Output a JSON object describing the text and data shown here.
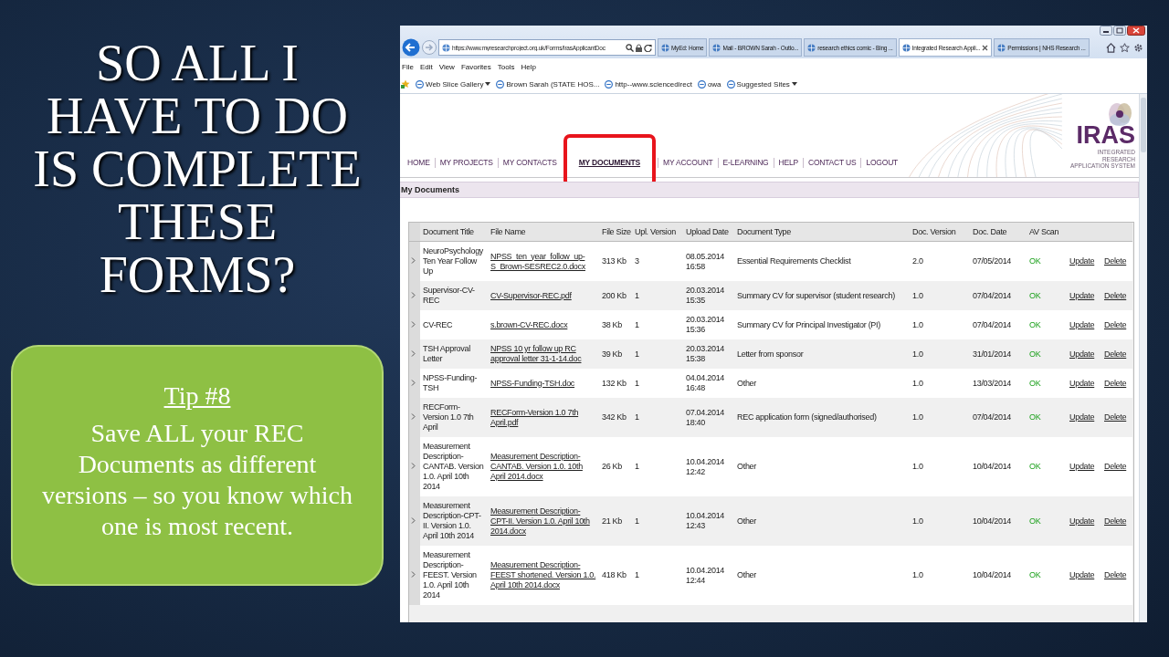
{
  "slide": {
    "title": "SO ALL I HAVE TO DO IS COMPLETE THESE FORMS?",
    "tip": {
      "heading": "Tip #8",
      "text": "Save ALL your REC Documents as different versions – so you know which one is most recent."
    }
  },
  "browser": {
    "address": "https://www.myresearchproject.org.uk/Forms/IrasApplicantDoc",
    "tabs": [
      {
        "label": "MyEd: Home",
        "selected": false
      },
      {
        "label": "Mail - BROWN Sarah - Outlo...",
        "selected": false
      },
      {
        "label": "research ethics comic - Bing ...",
        "selected": false
      },
      {
        "label": "Integrated Research Appli...",
        "selected": true
      },
      {
        "label": "Permissions | NHS Research ...",
        "selected": false
      }
    ],
    "menu": [
      "File",
      "Edit",
      "View",
      "Favorites",
      "Tools",
      "Help"
    ],
    "favorites": [
      {
        "label": "Web Slice Gallery",
        "dropdown": true
      },
      {
        "label": "Brown Sarah (STATE HOS...",
        "dropdown": false
      },
      {
        "label": "http--www.sciencedirect",
        "dropdown": false
      },
      {
        "label": "owa",
        "dropdown": false
      },
      {
        "label": "Suggested Sites",
        "dropdown": true
      }
    ]
  },
  "site": {
    "logo": {
      "name": "IRAS",
      "subtitle": "INTEGRATED RESEARCH APPLICATION SYSTEM"
    },
    "nav": [
      {
        "label": "HOME",
        "selected": false,
        "highlighted": false
      },
      {
        "label": "MY PROJECTS",
        "selected": false,
        "highlighted": false
      },
      {
        "label": "MY CONTACTS",
        "selected": false,
        "highlighted": false
      },
      {
        "label": "MY DOCUMENTS",
        "selected": true,
        "highlighted": true
      },
      {
        "label": "MY ACCOUNT",
        "selected": false,
        "highlighted": false
      },
      {
        "label": "E-LEARNING",
        "selected": false,
        "highlighted": false
      },
      {
        "label": "HELP",
        "selected": false,
        "highlighted": false
      },
      {
        "label": "CONTACT US",
        "selected": false,
        "highlighted": false
      },
      {
        "label": "LOGOUT",
        "selected": false,
        "highlighted": false
      }
    ],
    "section_title": "My Documents",
    "table": {
      "columns": [
        "Document Title",
        "File Name",
        "File Size",
        "Upl. Version",
        "Upload Date",
        "Document Type",
        "Doc. Version",
        "Doc. Date",
        "AV Scan"
      ],
      "rows": [
        {
          "title": "NeuroPsychology Ten Year Follow Up",
          "file_name": "NPSS_ten_year_follow_up-S_Brown-SESREC2.0.docx",
          "file_size": "313 Kb",
          "upl_version": "3",
          "upload_date": "08.05.2014 16:58",
          "document_type": "Essential Requirements Checklist",
          "doc_version": "2.0",
          "doc_date": "07/05/2014",
          "av_scan": "OK",
          "actions": [
            "Update",
            "Delete"
          ]
        },
        {
          "title": "Supervisor-CV-REC",
          "file_name": "CV-Supervisor-REC.pdf",
          "file_size": "200 Kb",
          "upl_version": "1",
          "upload_date": "20.03.2014 15:35",
          "document_type": "Summary CV for supervisor (student research)",
          "doc_version": "1.0",
          "doc_date": "07/04/2014",
          "av_scan": "OK",
          "actions": [
            "Update",
            "Delete"
          ]
        },
        {
          "title": "CV-REC",
          "file_name": "s.brown-CV-REC.docx",
          "file_size": "38 Kb",
          "upl_version": "1",
          "upload_date": "20.03.2014 15:36",
          "document_type": "Summary CV for Principal Investigator (PI)",
          "doc_version": "1.0",
          "doc_date": "07/04/2014",
          "av_scan": "OK",
          "actions": [
            "Update",
            "Delete"
          ]
        },
        {
          "title": "TSH Approval Letter",
          "file_name": "NPSS 10 yr follow up RC approval letter 31-1-14.doc",
          "file_size": "39 Kb",
          "upl_version": "1",
          "upload_date": "20.03.2014 15:38",
          "document_type": "Letter from sponsor",
          "doc_version": "1.0",
          "doc_date": "31/01/2014",
          "av_scan": "OK",
          "actions": [
            "Update",
            "Delete"
          ]
        },
        {
          "title": "NPSS-Funding-TSH",
          "file_name": "NPSS-Funding-TSH.doc",
          "file_size": "132 Kb",
          "upl_version": "1",
          "upload_date": "04.04.2014 16:48",
          "document_type": "Other",
          "doc_version": "1.0",
          "doc_date": "13/03/2014",
          "av_scan": "OK",
          "actions": [
            "Update",
            "Delete"
          ]
        },
        {
          "title": "RECForm-Version 1.0 7th April",
          "file_name": "RECForm-Version 1.0 7th April.pdf",
          "file_size": "342 Kb",
          "upl_version": "1",
          "upload_date": "07.04.2014 18:40",
          "document_type": "REC application form (signed/authorised)",
          "doc_version": "1.0",
          "doc_date": "07/04/2014",
          "av_scan": "OK",
          "actions": [
            "Update",
            "Delete"
          ]
        },
        {
          "title": "Measurement Description-CANTAB. Version 1.0. April 10th 2014",
          "file_name": "Measurement Description- CANTAB. Version 1.0. 10th April 2014.docx",
          "file_size": "26 Kb",
          "upl_version": "1",
          "upload_date": "10.04.2014 12:42",
          "document_type": "Other",
          "doc_version": "1.0",
          "doc_date": "10/04/2014",
          "av_scan": "OK",
          "actions": [
            "Update",
            "Delete"
          ]
        },
        {
          "title": "Measurement Description-CPT-II. Version 1.0. April 10th 2014",
          "file_name": "Measurement Description- CPT-II. Version 1.0. April 10th 2014.docx",
          "file_size": "21 Kb",
          "upl_version": "1",
          "upload_date": "10.04.2014 12:43",
          "document_type": "Other",
          "doc_version": "1.0",
          "doc_date": "10/04/2014",
          "av_scan": "OK",
          "actions": [
            "Update",
            "Delete"
          ]
        },
        {
          "title": "Measurement Description-FEEST. Version 1.0. April 10th 2014",
          "file_name": "Measurement Description- FEEST shortened. Version 1.0. April 10th 2014.docx",
          "file_size": "418 Kb",
          "upl_version": "1",
          "upload_date": "10.04.2014 12:44",
          "document_type": "Other",
          "doc_version": "1.0",
          "doc_date": "10/04/2014",
          "av_scan": "OK",
          "actions": [
            "Update",
            "Delete"
          ]
        }
      ]
    }
  }
}
